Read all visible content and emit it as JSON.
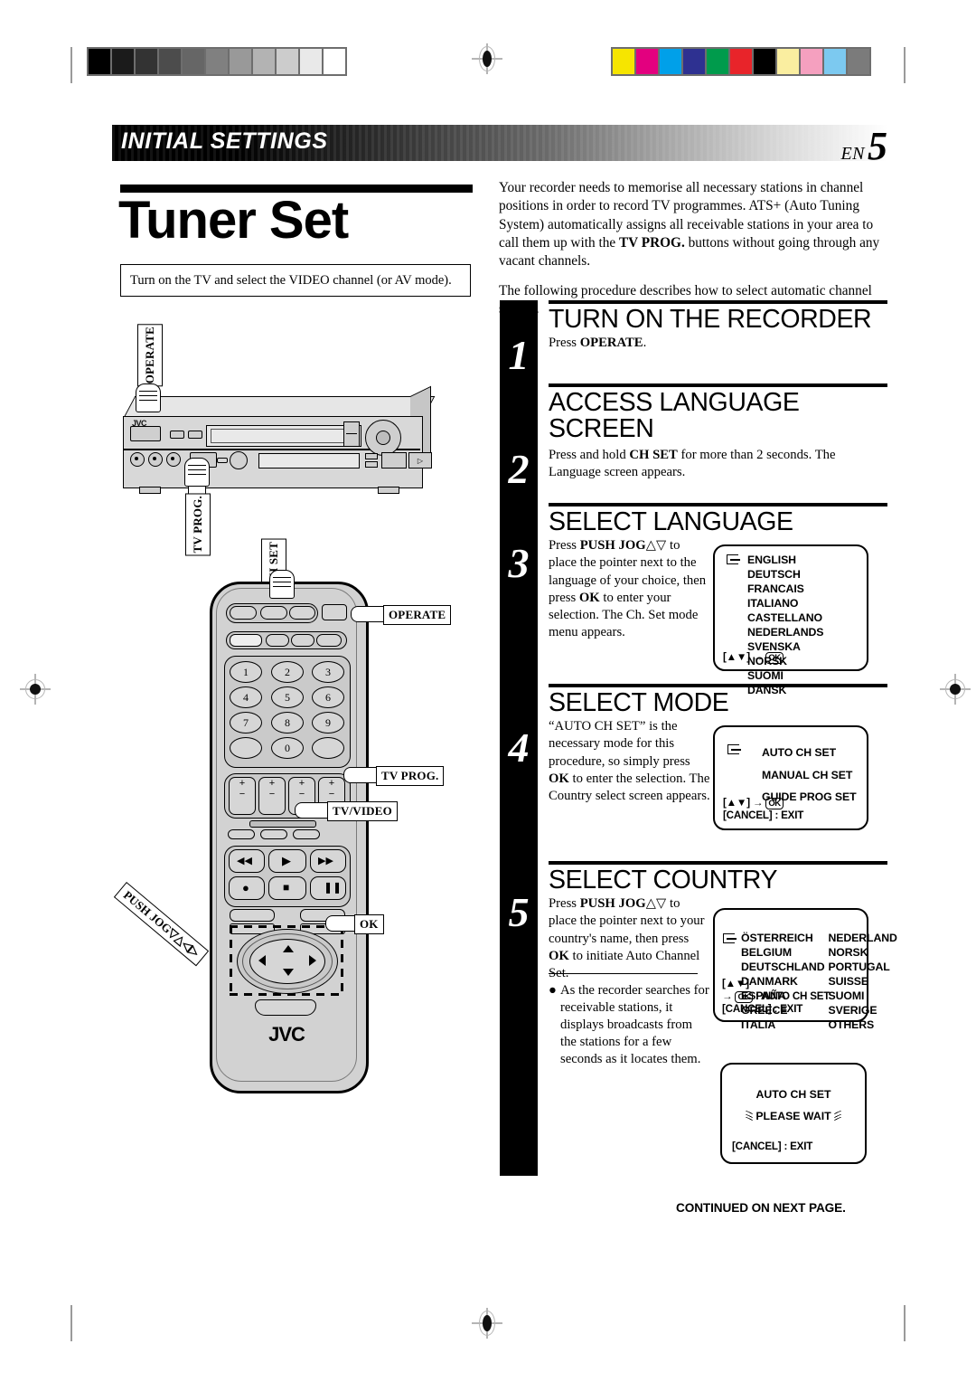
{
  "header": {
    "section_title": "INITIAL SETTINGS",
    "lang_code": "EN",
    "page_number": "5"
  },
  "left": {
    "doc_title": "Tuner Set",
    "note": "Turn on the TV and select the VIDEO channel (or AV mode).",
    "vcr_callouts": {
      "operate": "OPERATE",
      "tv_prog": "TV PROG.",
      "ch_set": "CH SET"
    },
    "remote_callouts": {
      "operate": "OPERATE",
      "tv_prog": "TV PROG.",
      "tv_video": "TV/VIDEO",
      "ok": "OK",
      "push_jog": "PUSH JOG▽△◁▷"
    },
    "remote_brand": "JVC",
    "remote_keys": [
      "1",
      "2",
      "3",
      "4",
      "5",
      "6",
      "7",
      "8",
      "9",
      "0"
    ]
  },
  "intro": {
    "p1_a": "Your recorder needs to memorise all necessary stations in channel positions in order to record TV programmes. ATS+ (Auto Tuning System) automatically assigns all receivable stations in your area to call them up with the ",
    "p1_b": "TV PROG.",
    "p1_c": " buttons without going through any vacant channels.",
    "p2": "The following procedure describes how to select automatic channel setting."
  },
  "steps": [
    {
      "number": "1",
      "heading": "TURN ON THE RECORDER",
      "body_a": "Press ",
      "body_b": "OPERATE",
      "body_c": "."
    },
    {
      "number": "2",
      "heading": "ACCESS LANGUAGE SCREEN",
      "body_a": "Press and hold ",
      "body_b": "CH SET",
      "body_c": " for more than 2 seconds. The Language screen appears."
    },
    {
      "number": "3",
      "heading": "SELECT LANGUAGE",
      "body_a": "Press ",
      "body_b": "PUSH JOG",
      "body_c": "△▽ to place the pointer next to the language of your choice, then press ",
      "body_d": "OK",
      "body_e": " to enter your selection. The Ch. Set mode menu appears."
    },
    {
      "number": "4",
      "heading": "SELECT MODE",
      "body_a": "“AUTO CH SET” is the necessary mode for this procedure, so simply press ",
      "body_b": "OK",
      "body_c": " to enter the selection. The Country select screen appears."
    },
    {
      "number": "5",
      "heading": "SELECT COUNTRY",
      "body_a": "Press ",
      "body_b": "PUSH JOG",
      "body_c": "△▽ to place the pointer next to your country's name, then press ",
      "body_d": "OK",
      "body_e": " to initiate Auto Channel Set.",
      "bullet": "As the recorder searches for receivable stations, it displays broadcasts from the stations for a few seconds as it locates them."
    }
  ],
  "osd": {
    "language": {
      "items": [
        "ENGLISH",
        "DEUTSCH",
        "FRANCAIS",
        "ITALIANO",
        "CASTELLANO",
        "NEDERLANDS",
        "SVENSKA",
        "NORSK",
        "SUOMI",
        "DANSK"
      ],
      "footer_keys": "[▲▼] →",
      "footer_ok": "OK"
    },
    "mode": {
      "items": [
        "AUTO CH SET",
        "MANUAL CH SET",
        "GUIDE PROG SET"
      ],
      "footer_keys": "[▲▼] →",
      "footer_ok": "OK",
      "footer_cancel": "[CANCEL] : EXIT"
    },
    "country": {
      "col1": [
        "ÖSTERREICH",
        "BELGIUM",
        "DEUTSCHLAND",
        "DANMARK",
        "ESPAÑA",
        "GREECE",
        "ITALIA"
      ],
      "col2": [
        "NEDERLAND",
        "NORSK",
        "PORTUGAL",
        "SUISSE",
        "SUOMI",
        "SVERIGE",
        "OTHERS"
      ],
      "footer_keys": "[▲▼]",
      "footer_arrow": "→",
      "footer_ok": "OK",
      "footer_ok_action": ": AUTO CH SET",
      "footer_cancel": "[CANCEL] : EXIT"
    },
    "wait": {
      "title": "AUTO CH SET",
      "message": "PLEASE WAIT",
      "footer_cancel": "[CANCEL] : EXIT"
    }
  },
  "footer": {
    "continued": "CONTINUED ON NEXT PAGE."
  },
  "calibration": {
    "grey_swatches": [
      "#000000",
      "#1b1b1b",
      "#333333",
      "#4c4c4c",
      "#666666",
      "#808080",
      "#999999",
      "#b3b3b3",
      "#cccccc",
      "#e9e9e9",
      "#ffffff"
    ],
    "colour_swatches": [
      "#f6e500",
      "#e3007f",
      "#00a0e9",
      "#2e3191",
      "#009b4c",
      "#e8242a",
      "#000000",
      "#faeea0",
      "#f5a0bf",
      "#7cc9f0",
      "#7b7b7b"
    ]
  }
}
